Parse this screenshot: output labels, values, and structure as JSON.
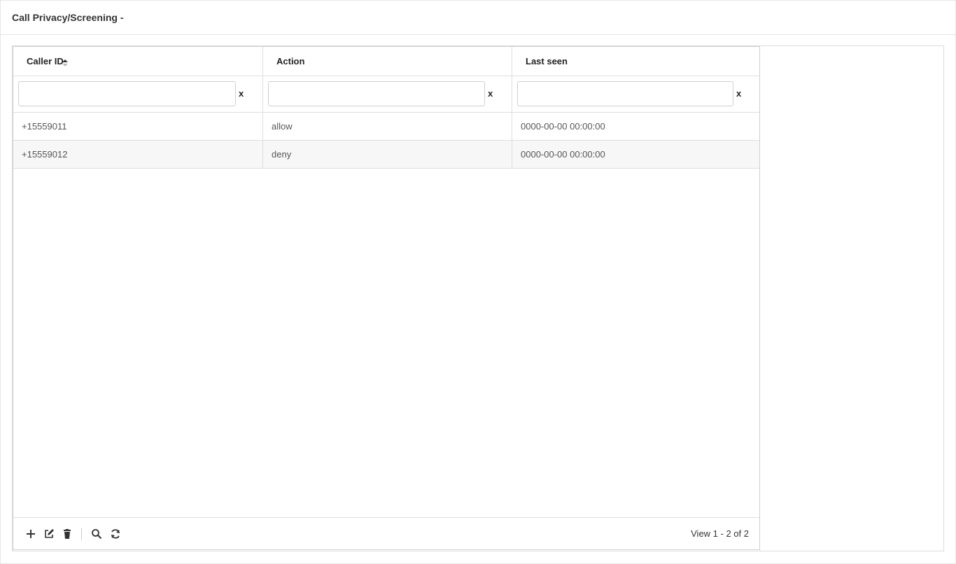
{
  "panel": {
    "title": "Call Privacy/Screening -"
  },
  "grid": {
    "columns": [
      {
        "label": "Caller ID",
        "sorted": "asc"
      },
      {
        "label": "Action"
      },
      {
        "label": "Last seen"
      }
    ],
    "filters": [
      {
        "value": "",
        "clear_label": "x"
      },
      {
        "value": "",
        "clear_label": "x"
      },
      {
        "value": "",
        "clear_label": "x"
      }
    ],
    "rows": [
      {
        "caller_id": "+15559011",
        "action": "allow",
        "last_seen": "0000-00-00 00:00:00"
      },
      {
        "caller_id": "+15559012",
        "action": "deny",
        "last_seen": "0000-00-00 00:00:00"
      }
    ],
    "pager": {
      "tools": [
        "plus-icon",
        "edit-icon",
        "trash-icon",
        "search-icon",
        "refresh-icon"
      ],
      "view_text": "View 1 - 2 of 2"
    }
  }
}
